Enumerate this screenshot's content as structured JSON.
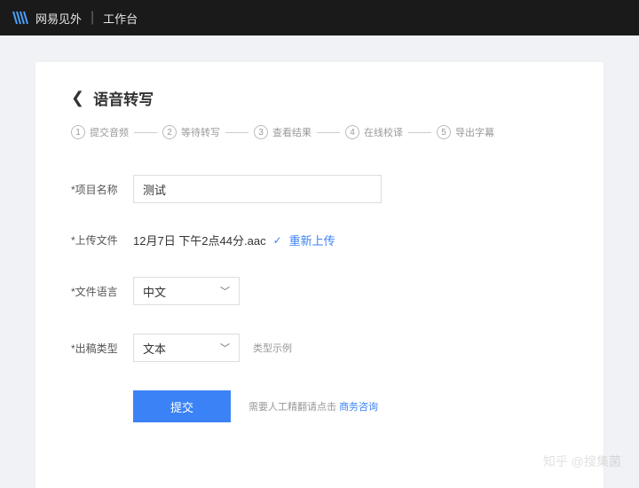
{
  "nav": {
    "brand": "网易见外",
    "separator": "|",
    "sub": "工作台"
  },
  "page": {
    "title": "语音转写"
  },
  "steps": [
    {
      "num": "1",
      "label": "提交音频"
    },
    {
      "num": "2",
      "label": "等待转写"
    },
    {
      "num": "3",
      "label": "查看结果"
    },
    {
      "num": "4",
      "label": "在线校译"
    },
    {
      "num": "5",
      "label": "导出字幕"
    }
  ],
  "form": {
    "project_label": "*项目名称",
    "project_value": "测试",
    "upload_label": "*上传文件",
    "file_name": "12月7日 下午2点44分.aac",
    "reupload": "重新上传",
    "language_label": "*文件语言",
    "language_value": "中文",
    "output_label": "*出稿类型",
    "output_value": "文本",
    "output_hint": "类型示例"
  },
  "footer": {
    "submit": "提交",
    "help_prefix": "需要人工精翻请点击 ",
    "help_link": "商务咨询"
  },
  "watermark": "知乎 @搜集菌"
}
